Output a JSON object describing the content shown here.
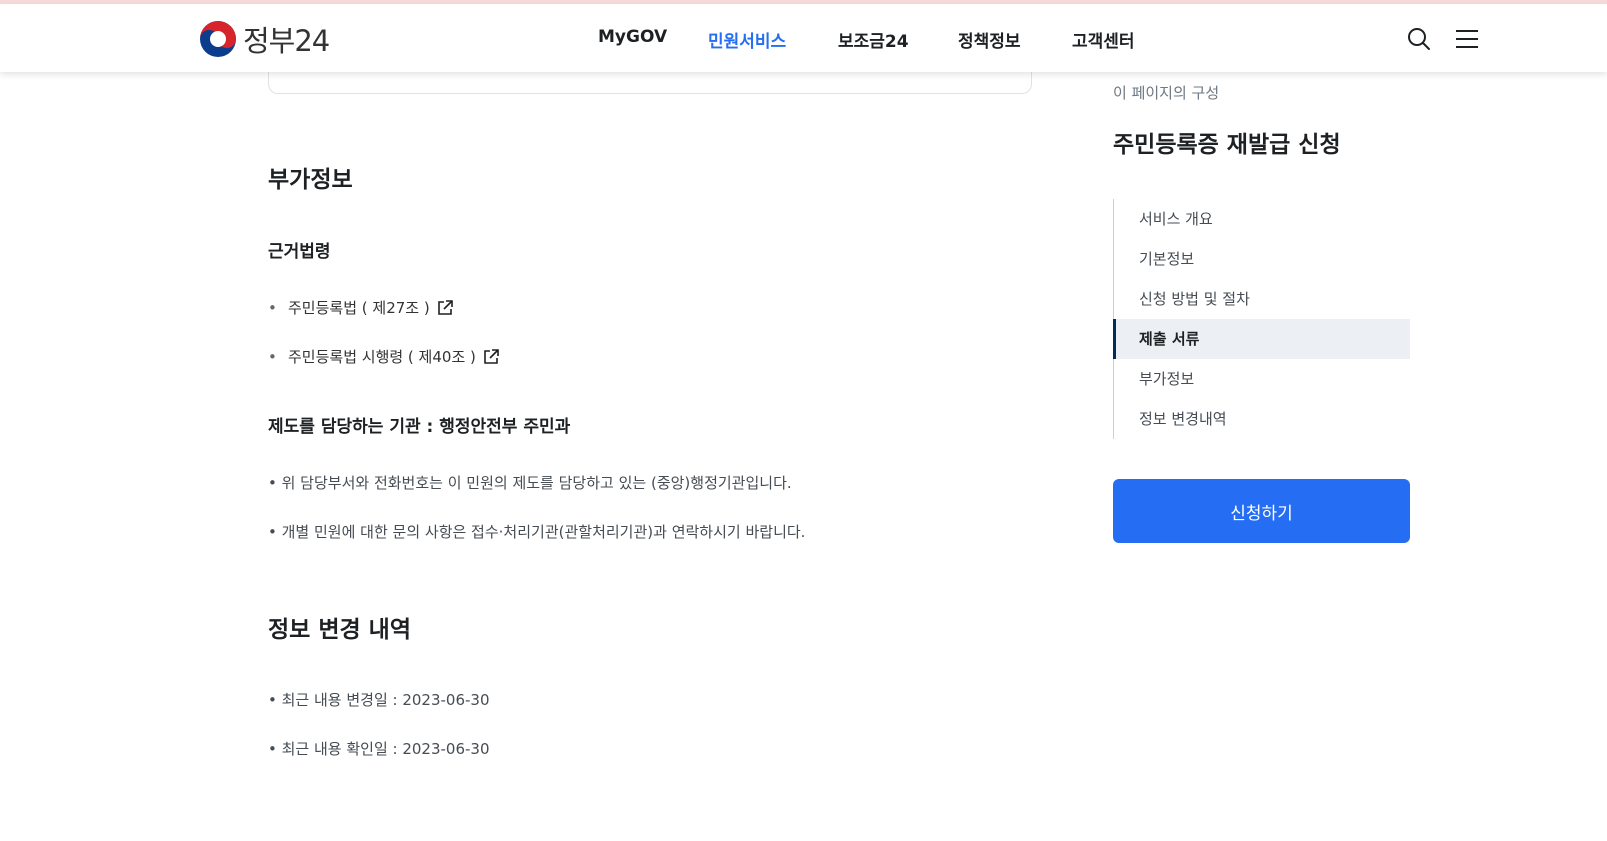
{
  "header": {
    "logo_text": "정부24",
    "nav": [
      "MyGOV",
      "민원서비스",
      "보조금24",
      "정책정보",
      "고객센터"
    ],
    "active_nav": "민원서비스",
    "icons": [
      "search-icon",
      "menu-icon"
    ]
  },
  "extra_info": {
    "heading": "부가정보",
    "law": {
      "heading": "근거법령",
      "items": [
        "주민등록법 ( 제27조 )",
        "주민등록법 시행령 ( 제40조 )"
      ]
    },
    "agency": {
      "heading": "제도를 담당하는 기관 : 행정안전부  주민과",
      "notes": [
        "• 위 담당부서와 전화번호는 이 민원의 제도를 담당하고 있는 (중앙)행정기관입니다.",
        "• 개별 민원에 대한 문의 사항은 접수·처리기관(관할처리기관)과 연락하시기 바랍니다."
      ]
    }
  },
  "change_history": {
    "heading": "정보 변경 내역",
    "items": [
      "• 최근 내용 변경일 : 2023-06-30",
      "• 최근 내용 확인일 : 2023-06-30"
    ]
  },
  "toc": {
    "caption": "이 페이지의 구성",
    "title": "주민등록증 재발급 신청",
    "items": [
      "서비스 개요",
      "기본정보",
      "신청 방법 및 절차",
      "제출 서류",
      "부가정보",
      "정보 변경내역"
    ],
    "active_index": 3
  },
  "apply_button": "신청하기",
  "colors": {
    "accent": "#256ef4",
    "toc_active_bar": "#052b57",
    "toc_active_bg": "#eceff3"
  }
}
